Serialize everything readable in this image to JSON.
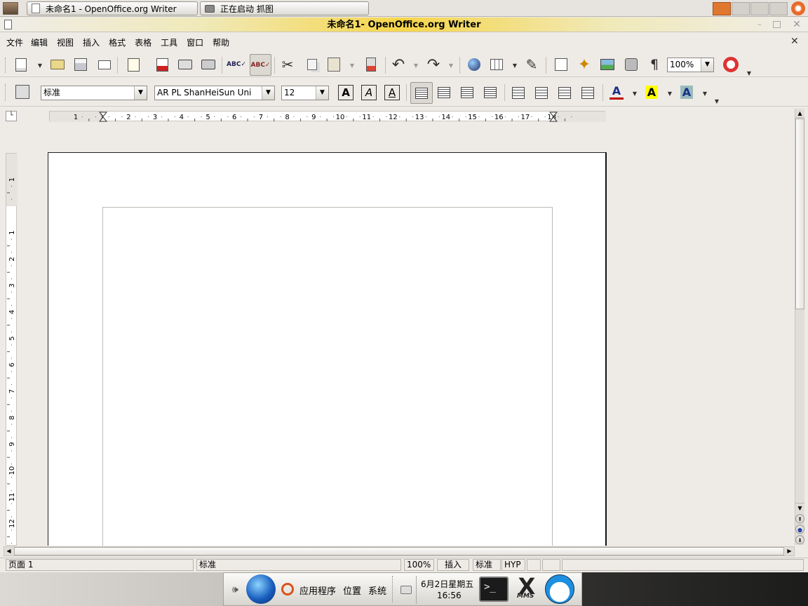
{
  "top_taskbar": {
    "tasks": [
      {
        "label": "未命名1 - OpenOffice.org Writer"
      },
      {
        "label": "正在启动 抓图"
      }
    ]
  },
  "window": {
    "title": "未命名1-  OpenOffice.org Writer"
  },
  "menu": {
    "items": [
      "文件",
      "编辑",
      "视图",
      "插入",
      "格式",
      "表格",
      "工具",
      "窗口",
      "帮助"
    ]
  },
  "standard_toolbar": {
    "zoom_value": "100%"
  },
  "format_toolbar": {
    "style_value": "标准",
    "font_value": "AR PL ShanHeiSun Uni",
    "size_value": "12",
    "bold_label": "A",
    "italic_label": "A",
    "underline_label": "A",
    "font_color": "#c00000",
    "highlight_color": "#ffff00"
  },
  "ruler": {
    "h_ticks": [
      "1",
      "1",
      "2",
      "3",
      "4",
      "5",
      "6",
      "7",
      "8",
      "9",
      "10",
      "11",
      "12",
      "13",
      "14",
      "15",
      "16",
      "17",
      "18"
    ],
    "v_ticks": [
      "1",
      "1",
      "2",
      "3",
      "4",
      "5",
      "6",
      "7",
      "8",
      "9",
      "10",
      "11",
      "12"
    ]
  },
  "status": {
    "page": "页面 1",
    "style": "标准",
    "zoom": "100%",
    "mode": "插入",
    "selection": "标准",
    "hyp": "HYP"
  },
  "bottom_panel": {
    "apps_label": "应用程序",
    "places_label": "位置",
    "system_label": "系统",
    "date": "6月2日星期五",
    "time": "16:56",
    "mms_label": "MMS"
  }
}
